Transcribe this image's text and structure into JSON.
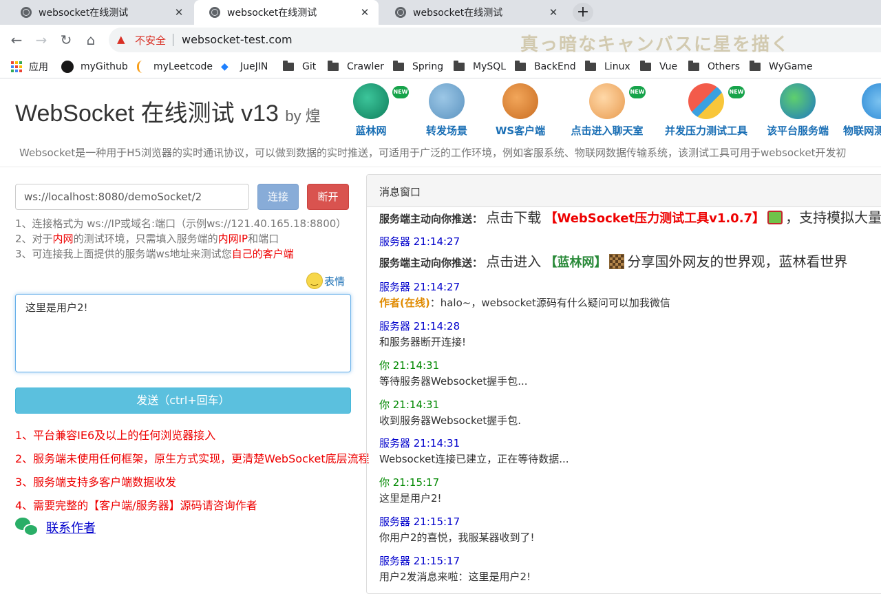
{
  "tabs": [
    {
      "title": "websocket在线测试",
      "active": false
    },
    {
      "title": "websocket在线测试",
      "active": true
    },
    {
      "title": "websocket在线测试",
      "active": false
    }
  ],
  "toolbar": {
    "back": "←",
    "forward": "→",
    "reload": "↻",
    "home": "⌂",
    "insecure_label": "不安全",
    "url": "websocket-test.com",
    "overlay_text": "真っ暗なキャンバスに星を描く"
  },
  "bookmarks": {
    "apps": "应用",
    "items": [
      "myGithub",
      "myLeetcode",
      "JueJIN",
      "Git",
      "Crawler",
      "Spring",
      "MySQL",
      "BackEnd",
      "Linux",
      "Vue",
      "Others",
      "WyGame"
    ]
  },
  "site": {
    "title": "WebSocket 在线测试 v13",
    "by": "by 煌",
    "nav": [
      {
        "label": "蓝林网",
        "icon": "globe-icon",
        "new": true,
        "color": "#1aa37a"
      },
      {
        "label": "转发场景",
        "icon": "antenna-icon",
        "new": false,
        "color": "#6fa7d2"
      },
      {
        "label": "WS客户端",
        "icon": "speaker-icon",
        "new": false,
        "color": "#e08a3a"
      },
      {
        "label": "点击进入聊天室",
        "icon": "chat-users-icon",
        "new": true,
        "color": "#f3b35c"
      },
      {
        "label": "并发压力测试工具",
        "icon": "pencil-ruler-icon",
        "new": true,
        "color": "#e94b3c"
      },
      {
        "label": "该平台服务端",
        "icon": "earth-icon",
        "new": false,
        "color": "#3ea0d6"
      },
      {
        "label": "物联网测",
        "icon": "cloud-icon",
        "new": false,
        "color": "#3b9ee0"
      }
    ],
    "new_badge": "NEW",
    "description": "Websocket是一种用于H5浏览器的实时通讯协议，可以做到数据的实时推送，可适用于广泛的工作环境，例如客服系统、物联网数据传输系统，该测试工具可用于websocket开发初"
  },
  "left": {
    "ws_url": "ws://localhost:8080/demoSocket/2",
    "connect_label": "连接",
    "disconnect_label": "断开",
    "hint1": "1、连接格式为 ws://IP或域名:端口（示例ws://121.40.165.18:8800）",
    "hint2_a": "2、对于",
    "hint2_b": "内网",
    "hint2_c": "的测试环境，只需填入服务端的",
    "hint2_d": "内网IP",
    "hint2_e": "和端口",
    "hint3_a": "3、可连接我上面提供的服务端ws地址来测试您",
    "hint3_b": "自己的客户端",
    "emoji_label": "表情",
    "message": "这里是用户2!",
    "send_label": "发送（ctrl+回车）",
    "features": [
      "1、平台兼容IE6及以上的任何浏览器接入",
      "2、服务端未使用任何框架，原生方式实现，更清楚WebSocket底层流程",
      "3、服务端支持多客户端数据收发",
      "4、需要完整的【客户端/服务器】源码请咨询作者"
    ],
    "contact_label": "联系作者"
  },
  "panel": {
    "title": "消息窗口",
    "push1_prefix": "服务端主动向你推送：",
    "push1_text_a": "点击下载",
    "push1_link": "【WebSocket压力测试工具v1.0.7】",
    "push1_text_b": "，支持模拟大量",
    "server_time_1": "服务器 21:14:27",
    "push2_prefix": "服务端主动向你推送：",
    "push2_text_a": "点击进入",
    "push2_link": "【蓝林网】",
    "push2_text_b": "分享国外网友的世界观，蓝林看世界",
    "server_time_2": "服务器 21:14:27",
    "author_label": "作者(在线)",
    "author_text": "：halo~，websocket源码有什么疑问可以加我微信",
    "server_time_3": "服务器 21:14:28",
    "text_3": "和服务器断开连接!",
    "you_time_1": "你 21:14:31",
    "text_4": "等待服务器Websocket握手包...",
    "you_time_2": "你 21:14:31",
    "text_5": "收到服务器Websocket握手包.",
    "server_time_4": "服务器 21:14:31",
    "text_6": "Websocket连接已建立，正在等待数据...",
    "you_time_3": "你 21:15:17",
    "text_7": "这里是用户2!",
    "server_time_5": "服务器 21:15:17",
    "text_8": "你用户2的喜悦，我服某器收到了!",
    "server_time_6": "服务器 21:15:17",
    "text_9": "用户2发消息来啦：这里是用户2!"
  }
}
